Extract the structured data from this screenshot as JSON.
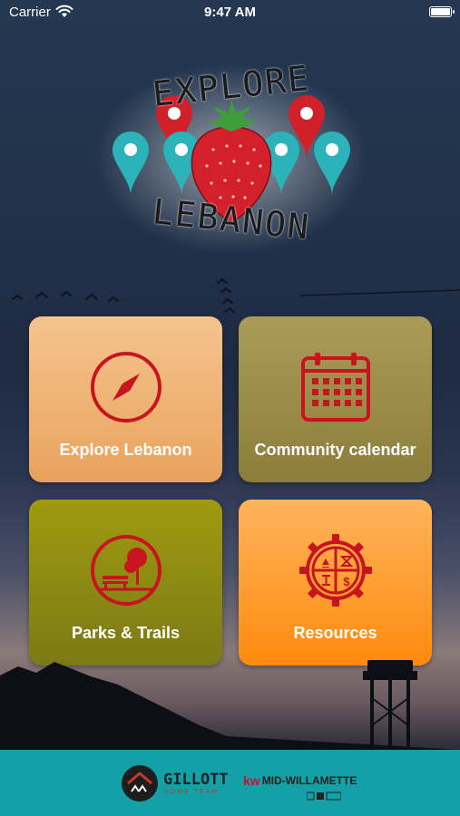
{
  "status_bar": {
    "carrier": "Carrier",
    "time": "9:47 AM"
  },
  "logo": {
    "top_text": "EXPLORE",
    "bottom_text": "LEBANON"
  },
  "tiles": [
    {
      "label": "Explore Lebanon",
      "icon": "compass-icon"
    },
    {
      "label": "Community calendar",
      "icon": "calendar-icon"
    },
    {
      "label": "Parks & Trails",
      "icon": "park-bench-tree-icon"
    },
    {
      "label": "Resources",
      "icon": "gear-resources-icon"
    }
  ],
  "footer": {
    "sponsor1": {
      "name": "GILLOTT",
      "tagline": "HOME TEAM"
    },
    "sponsor2": {
      "brand": "kw",
      "name": "MID-WILLAMETTE"
    }
  },
  "colors": {
    "tile_explore": "#eeb274",
    "tile_calendar": "#9c8c4a",
    "tile_parks": "#8d8a12",
    "tile_resources": "#ff9f35",
    "icon_red": "#c8141e",
    "footer_bg": "#13a0a6"
  }
}
